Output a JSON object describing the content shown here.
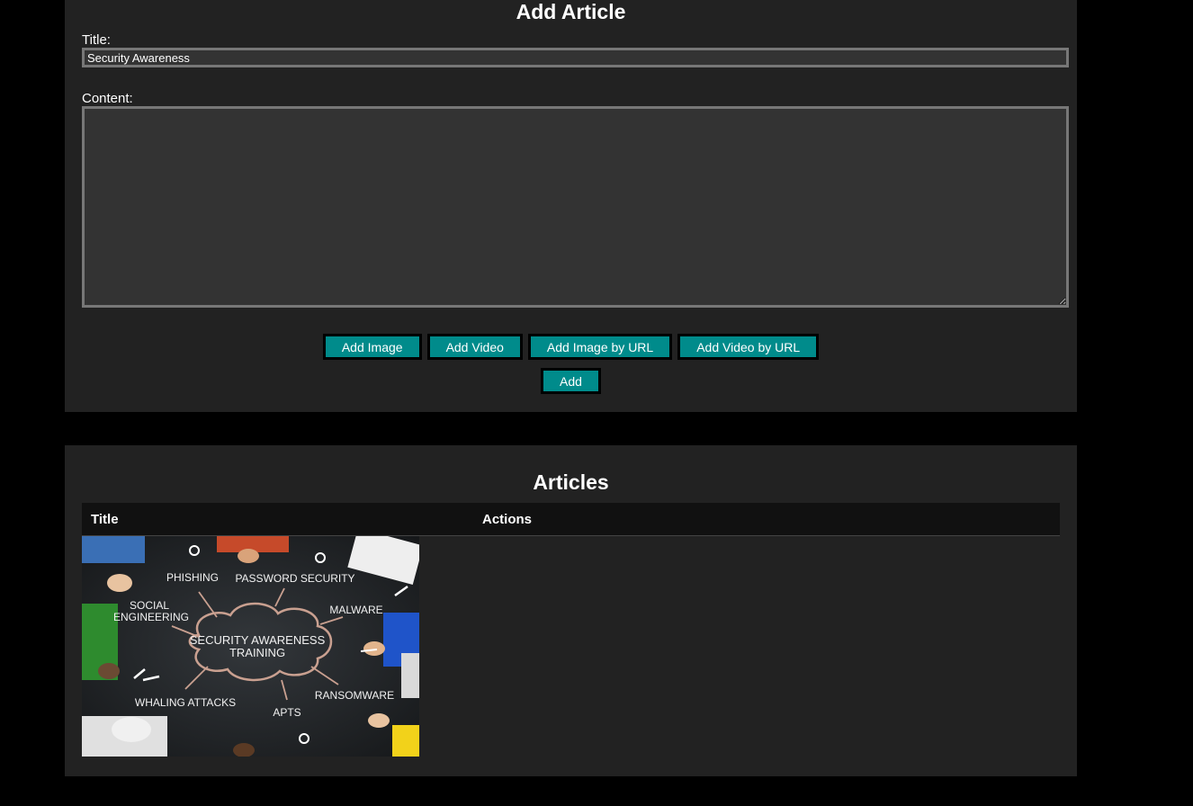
{
  "add_article": {
    "heading": "Add Article",
    "title_label": "Title:",
    "title_value": "Security Awareness",
    "content_label": "Content:",
    "content_value": "",
    "buttons": {
      "add_image": "Add Image",
      "add_video": "Add Video",
      "add_image_url": "Add Image by URL",
      "add_video_url": "Add Video by URL",
      "add": "Add"
    }
  },
  "articles": {
    "heading": "Articles",
    "columns": [
      "Title",
      "Actions"
    ],
    "rows": [
      {
        "thumbnail_words": {
          "center_line1": "SECURITY AWARENESS",
          "center_line2": "TRAINING",
          "phishing": "PHISHING",
          "password": "PASSWORD SECURITY",
          "social_line1": "SOCIAL",
          "social_line2": "ENGINEERING",
          "malware": "MALWARE",
          "whaling": "WHALING ATTACKS",
          "apts": "APTS",
          "ransomware": "RANSOMWARE"
        }
      }
    ]
  },
  "colors": {
    "page_bg": "#000000",
    "panel_bg": "#222222",
    "button_bg": "#008b8b",
    "header_bg": "#111111"
  }
}
